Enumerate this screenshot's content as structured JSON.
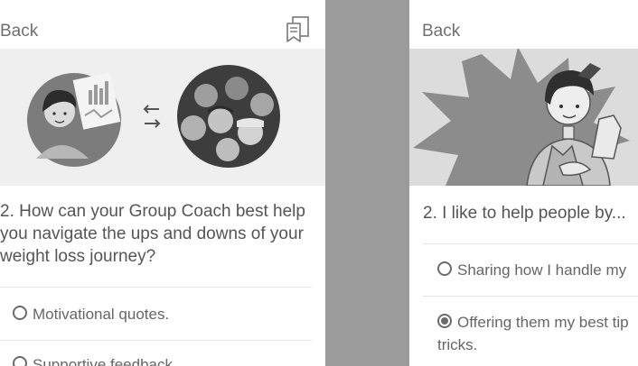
{
  "left": {
    "back_label": "Back",
    "question": "2. How can your Group Coach best help you navigate the ups and downs of your weight loss journey?",
    "options": [
      {
        "label": "Motivational quotes.",
        "selected": false
      },
      {
        "label": "Supportive feedback",
        "selected": false
      }
    ]
  },
  "right": {
    "back_label": "Back",
    "question": "2. I like to help people by...",
    "options": [
      {
        "label": "Sharing how I handle my",
        "selected": false
      },
      {
        "label": "Offering them my best tip",
        "label_line2": "tricks.",
        "selected": true
      }
    ]
  },
  "icons": {
    "bookmark": "bookmark-icon",
    "swap": "swap-arrows-icon"
  },
  "colors": {
    "divider": "#9b9b9b",
    "hero_bg_left": "#efefef",
    "hero_bg_right": "#dcdcdc",
    "text": "#555555"
  }
}
